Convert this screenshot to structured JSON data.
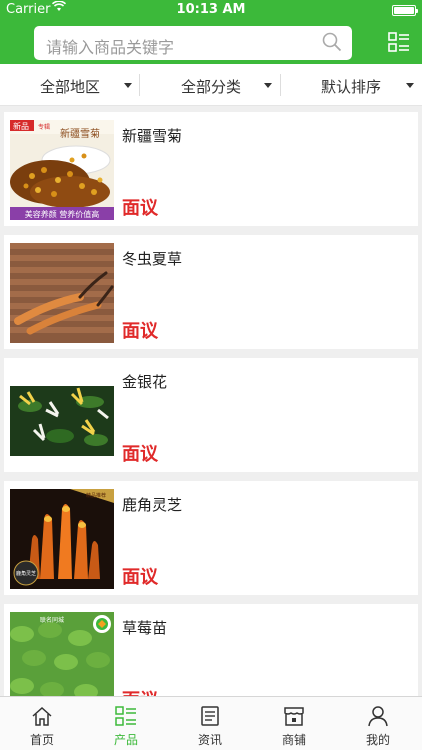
{
  "status": {
    "carrier": "Carrier",
    "time": "10:13 AM"
  },
  "search": {
    "placeholder": "请输入商品关键字"
  },
  "filters": [
    "全部地区",
    "全部分类",
    "默认排序"
  ],
  "products": [
    {
      "name": "新疆雪菊",
      "price": "面议"
    },
    {
      "name": "冬虫夏草",
      "price": "面议"
    },
    {
      "name": "金银花",
      "price": "面议"
    },
    {
      "name": "鹿角灵芝",
      "price": "面议"
    },
    {
      "name": "草莓苗",
      "price": "面议"
    }
  ],
  "thumb_text": {
    "p0_badge": "新品",
    "p0_badge2": "专辑",
    "p0_title": "新疆雪菊",
    "p0_banner": "美容养颜  营养价值高",
    "p3_badge": "精品推荐",
    "p3_caption": "鹿角灵芝",
    "p4_logo": "联名同城"
  },
  "tabs": [
    {
      "label": "首页",
      "icon": "home-icon"
    },
    {
      "label": "产品",
      "icon": "product-grid-icon"
    },
    {
      "label": "资讯",
      "icon": "news-icon"
    },
    {
      "label": "商铺",
      "icon": "shop-icon"
    },
    {
      "label": "我的",
      "icon": "user-icon"
    }
  ],
  "colors": {
    "brand": "#3cb93a",
    "price": "#e02a2a",
    "background": "#efefef"
  }
}
